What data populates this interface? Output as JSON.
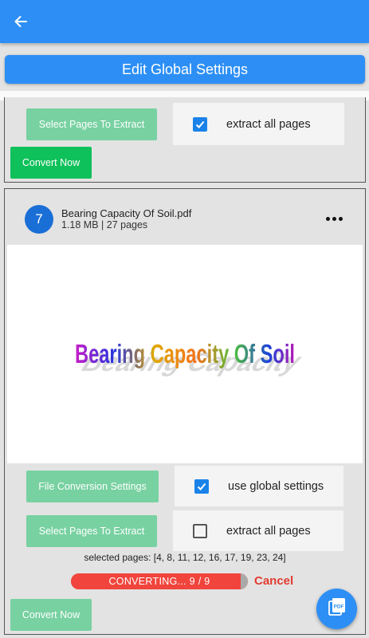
{
  "header": {
    "back_icon": "arrow-left-icon"
  },
  "global_settings_button": "Edit Global Settings",
  "card_top": {
    "select_pages_button": "Select Pages To Extract",
    "extract_all_label": "extract all pages",
    "extract_all_checked": true,
    "convert_button": "Convert Now"
  },
  "file_card": {
    "number": "7",
    "file_name": "Bearing Capacity Of Soil.pdf",
    "file_meta": "1.18 MB  |  27 pages",
    "menu_icon": "more-horizontal-icon",
    "preview_title": "Bearing Capacity Of Soil",
    "conversion_settings_button": "File Conversion Settings",
    "use_global_label": "use global settings",
    "use_global_checked": true,
    "select_pages_button": "Select Pages To Extract",
    "extract_all_label": "extract all pages",
    "extract_all_checked": false,
    "selected_pages_text": "selected pages: [4, 8, 11, 12, 16, 17, 19, 23, 24]",
    "progress_label": "CONVERTING... 9 / 9",
    "progress_fraction": 0.96,
    "cancel_label": "Cancel",
    "convert_button": "Convert Now"
  },
  "fab": {
    "icon": "pdf-file-icon"
  },
  "colors": {
    "primary": "#2d8ff5",
    "green_button": "#78d1a1",
    "green_button_active": "#0fc15a",
    "progress": "#f0443c",
    "cancel": "#e23b2f",
    "checkbox": "#1a82e8"
  }
}
